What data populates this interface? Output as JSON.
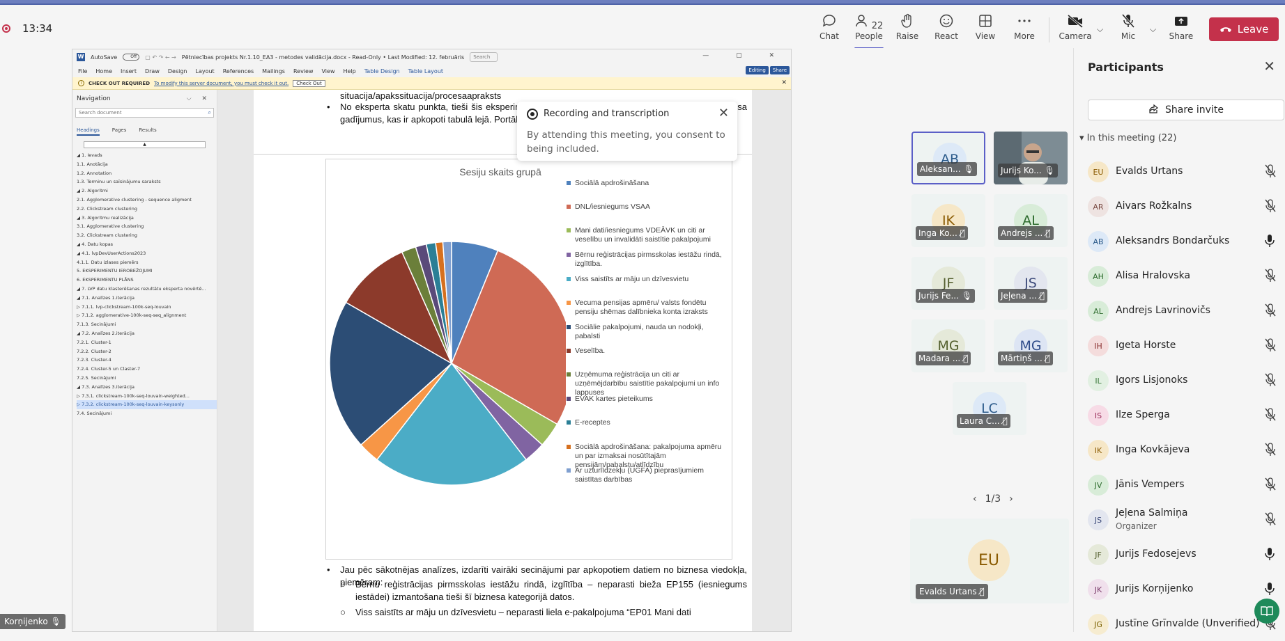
{
  "meeting": {
    "timer": "13:34",
    "toolbar": [
      {
        "label": "Chat",
        "icon": "chat-icon"
      },
      {
        "label": "People",
        "icon": "people-icon",
        "count": "22"
      },
      {
        "label": "Raise",
        "icon": "hand-icon"
      },
      {
        "label": "React",
        "icon": "smile-icon"
      },
      {
        "label": "View",
        "icon": "grid-icon"
      },
      {
        "label": "More",
        "icon": "more-icon"
      },
      {
        "label": "Camera",
        "icon": "camera-off-icon"
      },
      {
        "label": "Mic",
        "icon": "mic-off-icon"
      },
      {
        "label": "Share",
        "icon": "share-icon"
      }
    ],
    "leave_label": "Leave",
    "accent": "#5b5fc7",
    "leave_color": "#c4314b"
  },
  "toast": {
    "title": "Recording and transcription",
    "message": "By attending this meeting, you consent to being included."
  },
  "word": {
    "autosave": "AutoSave",
    "autosave_state": "Off",
    "title": "Pētniecības projekts Nr.1.10_EA3 - metodes validācija.docx - Read-Only • Last Modified: 12. februāris",
    "search": "Search",
    "ribbon": [
      "File",
      "Home",
      "Insert",
      "Draw",
      "Design",
      "Layout",
      "References",
      "Mailings",
      "Review",
      "View",
      "Help"
    ],
    "ribbon_accent": [
      "Table Design",
      "Table Layout"
    ],
    "ribbon_right": [
      "Editing",
      "Share"
    ],
    "checkout": {
      "title": "CHECK OUT REQUIRED",
      "link": "To modify this server document, you must check it out.",
      "button": "Check Out"
    }
  },
  "nav": {
    "title": "Navigation",
    "search_placeholder": "Search document",
    "tabs": [
      "Headings",
      "Pages",
      "Results"
    ],
    "items": [
      "◢  1. Ievads",
      "          1.1. Anotācija",
      "          1.2. Annotation",
      "          1.3. Terminu un saīsinājumu saraksts",
      "◢  2. Algoritmi",
      "          2.1. Agglomerative clustering - sequence aligment",
      "          2.2. Clickstream clustering",
      "◢  3. Algoritmu realizācija",
      "          3.1. Agglomerative clustering",
      "          3.2. Clickstream clustering",
      "◢  4. Datu kopas",
      "      ◢  4.1. lvpDevUserActions2023",
      "               4.1.1. Datu izlases piemērs",
      "     5. EKSPERIMENTU IEROBEŽOJUMI",
      "     6. EKSPERIMENTU PLĀNS",
      "◢  7. LVP datu klasterēšanas rezultātu eksperta novērtē...",
      "      ◢  7.1. Analīzes 1.iterācija",
      "           ▷  7.1.1. lvp-clickstream-100k-seq-louvain",
      "           ▷  7.1.2. agglomerative-100k-seq-seq_alignment",
      "               7.1.3. Secinājumi",
      "      ◢  7.2. Analīzes 2.iterācija",
      "               7.2.1. Cluster-1",
      "               7.2.2. Cluster-2",
      "               7.2.3. Cluster-4",
      "               7.2.4. Cluster-5 un Claster-7",
      "               7.2.5. Secinājumi",
      "      ◢  7.3. Analīzes 3.iterācija",
      "           ▷  7.3.1. clickstream-100k-seq-louvain-weighted...",
      "           ▷  7.3.2. clickstream-100k-seq-louvain-keysonly",
      "          7.4. Secinājumi"
    ],
    "selected_index": 28
  },
  "doc": {
    "top_line": "situacija/apakssituacija/procesaapraksts",
    "para1": "No eksperta skatu punkta, tieši šis eksperimentu sesiju dalījums deva iespēju saprast LVP biznesa gadījumus, kas ir apkopoti tabulā lejā. Portāla biznesa izmantošanas gadījumi vizuāli:",
    "para2": "Jau pēc sākotnējas analīzes, izdarīti vairāki secinājumi par apkopotiem datiem no biznesa viedokļa, piemēram:",
    "sub1": "Bērnu reģistrācijas pirmsskolas iestāžu rindā, izglītība – neparasti bieža EP155 (iesniegums iestādei) izmantošana tieši šī biznesa kategorijā datos.",
    "sub2": "Viss saistīts ar māju un dzīvesvietu – neparasti liela e-pakalpojuma “EP01 Mani dati"
  },
  "chart_data": {
    "type": "pie",
    "title": "Sesiju skaits grupā",
    "legend_position": "right",
    "categories": [
      "Sociālā apdrošināšana",
      "DNL/iesniegums VSAA",
      "Mani dati/iesniegums VDEĀVK un citi ar veselību un invalidāti saistītie pakalpojumi",
      "Bērnu reģistrācijas pirmsskolas iestāžu rindā, izglītība.",
      "Viss saistīts ar māju un dzīvesvietu",
      "Vecuma pensijas apmēru/ valsts fondētu pensiju shēmas dalībnieka konta izraksts",
      "Sociālie pakalpojumi, nauda un nodokļi, pabalsti",
      "Veselība.",
      "Uzņēmuma reģistrācija un citi ar uzņēmējdarbību saistītie pakalpojumi un info lappuses",
      "EVAK kartes pieteikums",
      "E-receptes",
      "Sociālā apdrošināšana: pakalpojuma apmēru un par izmaksai nosūtītajām pensijām/pabalstu/atlīdzību",
      "Ar uzturlīdzekļu (UGFA) pieprasījumiem saistītas darbības"
    ],
    "values": [
      6.5,
      28.5,
      3.5,
      3.0,
      22.0,
      3.0,
      21.0,
      10.5,
      2.0,
      1.5,
      1.3,
      1.0,
      1.2
    ],
    "colors": [
      "#4f81bd",
      "#cf6a55",
      "#9bbb59",
      "#8064a2",
      "#4bacc6",
      "#f79646",
      "#2c4d75",
      "#8c3a2b",
      "#6b7f3a",
      "#5a4a7a",
      "#2b7f96",
      "#d6701f",
      "#7f9fd0"
    ]
  },
  "tiles": [
    {
      "initials": "AB",
      "name": "Aleksan...",
      "mic": "on",
      "selected": true,
      "bg": "#dde9f7",
      "fg": "#2b5a8a"
    },
    {
      "initials": "",
      "name": "Jurijs Ko...",
      "mic": "on",
      "photo": true
    },
    {
      "initials": "IK",
      "name": "Inga Ko...",
      "mic": "off",
      "bg": "#f6e7c7",
      "fg": "#8a5a00"
    },
    {
      "initials": "AL",
      "name": "Andrejs ...",
      "mic": "off",
      "bg": "#d8ecd8",
      "fg": "#2d6b2d"
    },
    {
      "initials": "JF",
      "name": "Jurijs Fe...",
      "mic": "on",
      "bg": "#e5e9d9",
      "fg": "#55602f"
    },
    {
      "initials": "JS",
      "name": "Jeļena ...",
      "mic": "off",
      "bg": "#e3e6ef",
      "fg": "#3d4a7a"
    },
    {
      "initials": "MG",
      "name": "Madara ...",
      "mic": "off",
      "bg": "#e5e9d9",
      "fg": "#55602f"
    },
    {
      "initials": "MG",
      "name": "Mārtiņš ...",
      "mic": "off",
      "bg": "#dde5f4",
      "fg": "#2f4c8a"
    },
    {
      "initials": "LC",
      "name": "Laura C...",
      "mic": "off",
      "bg": "#dde9f7",
      "fg": "#2b5a8a"
    }
  ],
  "pager": "1/3",
  "spotlight": {
    "initials": "EU",
    "name": "Evalds Urtans"
  },
  "self_tag": "Korņijenko",
  "participants": {
    "title": "Participants",
    "share_invite": "Share invite",
    "in_meeting": "In this meeting (22)",
    "list": [
      {
        "initials": "EU",
        "name": "Evalds Urtans",
        "mic": "off",
        "bg": "#f6e7c7",
        "fg": "#8a5a00"
      },
      {
        "initials": "AR",
        "name": "Aivars Rožkalns",
        "mic": "off",
        "bg": "#eee3e1",
        "fg": "#7a4b43"
      },
      {
        "initials": "AB",
        "name": "Aleksandrs Bondarčuks",
        "mic": "on",
        "bg": "#dde9f7",
        "fg": "#2b5a8a"
      },
      {
        "initials": "AH",
        "name": "Alisa Hralovska",
        "mic": "off",
        "bg": "#d8ecd8",
        "fg": "#2d6b2d"
      },
      {
        "initials": "AL",
        "name": "Andrejs Lavrinovičs",
        "mic": "off",
        "bg": "#d8ecd8",
        "fg": "#2d6b2d"
      },
      {
        "initials": "IH",
        "name": "Igeta Horste",
        "mic": "off",
        "bg": "#f4dcdc",
        "fg": "#8a3030"
      },
      {
        "initials": "IL",
        "name": "Igors Lisjonoks",
        "mic": "off",
        "bg": "#e2f0e2",
        "fg": "#3a7a3a"
      },
      {
        "initials": "IS",
        "name": "Ilze Sperga",
        "mic": "off",
        "bg": "#f7dbe6",
        "fg": "#9a2d5a"
      },
      {
        "initials": "IK",
        "name": "Inga Kovkājeva",
        "mic": "off",
        "bg": "#f6e7c7",
        "fg": "#8a5a00"
      },
      {
        "initials": "JV",
        "name": "Jānis Vempers",
        "mic": "off",
        "bg": "#d8ecd8",
        "fg": "#2d6b2d"
      },
      {
        "initials": "JS",
        "name": "Jeļena Salmiņa",
        "role": "Organizer",
        "mic": "off",
        "bg": "#e3e6ef",
        "fg": "#3d4a7a"
      },
      {
        "initials": "JF",
        "name": "Jurijs Fedosejevs",
        "mic": "on",
        "bg": "#e5e9d9",
        "fg": "#55602f"
      },
      {
        "initials": "JK",
        "name": "Jurijs Korņijenko",
        "mic": "on",
        "bg": "#f0e0ec",
        "fg": "#7a3a6a"
      },
      {
        "initials": "JG",
        "name": "Justīne Grīnvalde (Unverified)",
        "mic": "off",
        "bg": "#f6ecd0",
        "fg": "#7a6000"
      }
    ]
  }
}
